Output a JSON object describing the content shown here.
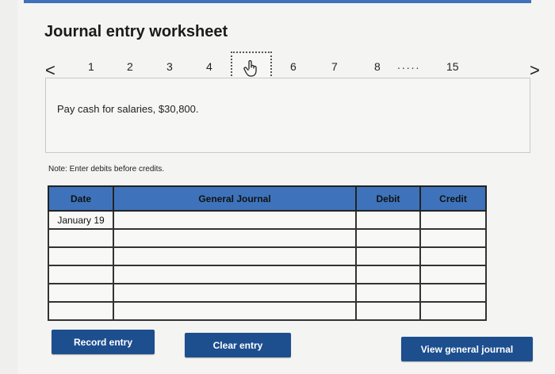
{
  "title": "Journal entry worksheet",
  "nav": {
    "prev_arrow": "<",
    "next_arrow": ">",
    "pages": [
      "1",
      "2",
      "3",
      "4",
      "6",
      "7",
      "8",
      "15"
    ],
    "ellipsis": "....."
  },
  "question": "Pay cash for salaries, $30,800.",
  "note": "Note: Enter debits before credits.",
  "table": {
    "headers": {
      "date": "Date",
      "journal": "General Journal",
      "debit": "Debit",
      "credit": "Credit"
    },
    "rows": [
      {
        "date": "January 19",
        "journal": "",
        "debit": "",
        "credit": ""
      },
      {
        "date": "",
        "journal": "",
        "debit": "",
        "credit": ""
      },
      {
        "date": "",
        "journal": "",
        "debit": "",
        "credit": ""
      },
      {
        "date": "",
        "journal": "",
        "debit": "",
        "credit": ""
      },
      {
        "date": "",
        "journal": "",
        "debit": "",
        "credit": ""
      },
      {
        "date": "",
        "journal": "",
        "debit": "",
        "credit": ""
      }
    ]
  },
  "buttons": {
    "record": "Record entry",
    "clear": "Clear entry",
    "view": "View general journal"
  },
  "colors": {
    "header_blue": "#3e73bb",
    "button_navy": "#1d4f8f"
  },
  "icons": {
    "current_page": "pointing-hand-icon"
  }
}
